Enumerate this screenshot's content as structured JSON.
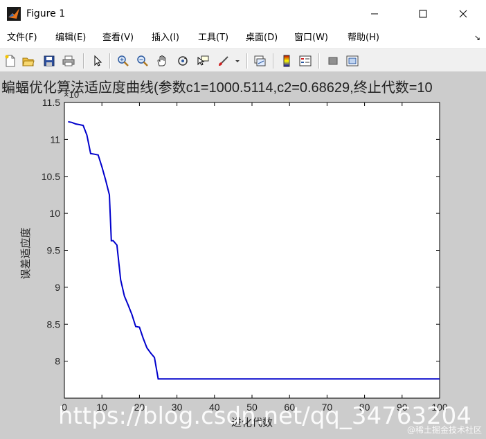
{
  "window": {
    "title": "Figure 1",
    "minimize_label": "—",
    "maximize_label": "☐",
    "close_label": "✕"
  },
  "menu": {
    "items": [
      {
        "label": "文件(F)",
        "key": "file"
      },
      {
        "label": "编辑(E)",
        "key": "edit"
      },
      {
        "label": "查看(V)",
        "key": "view"
      },
      {
        "label": "插入(I)",
        "key": "insert"
      },
      {
        "label": "工具(T)",
        "key": "tools"
      },
      {
        "label": "桌面(D)",
        "key": "desktop"
      },
      {
        "label": "窗口(W)",
        "key": "window"
      },
      {
        "label": "帮助(H)",
        "key": "help"
      }
    ],
    "overflow_icon": "↘"
  },
  "toolbar": {
    "icons": [
      "new-file-icon",
      "open-folder-icon",
      "save-icon",
      "print-icon",
      "pointer-icon",
      "zoom-in-icon",
      "zoom-out-icon",
      "pan-hand-icon",
      "rotate-3d-icon",
      "data-cursor-icon",
      "brush-icon",
      "link-plot-icon",
      "colorbar-icon",
      "legend-icon",
      "hide-plot-tools-icon",
      "show-plot-tools-icon"
    ]
  },
  "chart_data": {
    "type": "line",
    "title": "蝙蝠优化算法适应度曲线(参数c1=1000.5114,c2=0.68629,终止代数=10",
    "xlabel": "进化代数",
    "ylabel": "误差适应度",
    "exponent_label": "×10",
    "xlim": [
      0,
      100
    ],
    "ylim": [
      7.5,
      11.5
    ],
    "xticks": [
      0,
      10,
      20,
      30,
      40,
      50,
      60,
      70,
      80,
      90,
      100
    ],
    "yticks": [
      8,
      8.5,
      9,
      9.5,
      10,
      10.5,
      11,
      11.5
    ],
    "xtick_labels": [
      "0",
      "10",
      "20",
      "30",
      "40",
      "50",
      "60",
      "70",
      "80",
      "90",
      "100"
    ],
    "ytick_labels": [
      "8",
      "8.5",
      "9",
      "9.5",
      "10",
      "10.5",
      "11",
      "11.5"
    ],
    "grid": false,
    "line_color": "#0000cc",
    "series": [
      {
        "x": [
          1,
          2,
          3,
          4,
          5,
          6,
          7,
          8,
          9,
          10,
          11,
          12,
          12.5,
          13,
          14,
          15,
          16,
          17,
          18,
          19,
          20,
          21,
          22,
          23,
          24,
          25,
          100
        ],
        "y": [
          11.24,
          11.23,
          11.21,
          11.2,
          11.19,
          11.06,
          10.81,
          10.8,
          10.79,
          10.63,
          10.45,
          10.25,
          9.63,
          9.63,
          9.57,
          9.1,
          8.88,
          8.76,
          8.63,
          8.47,
          8.46,
          8.31,
          8.18,
          8.11,
          8.05,
          7.76,
          7.76
        ]
      }
    ]
  },
  "watermark": {
    "main": "https://blog.csdn.net/qq_34763204",
    "corner": "@稀土掘金技术社区"
  }
}
